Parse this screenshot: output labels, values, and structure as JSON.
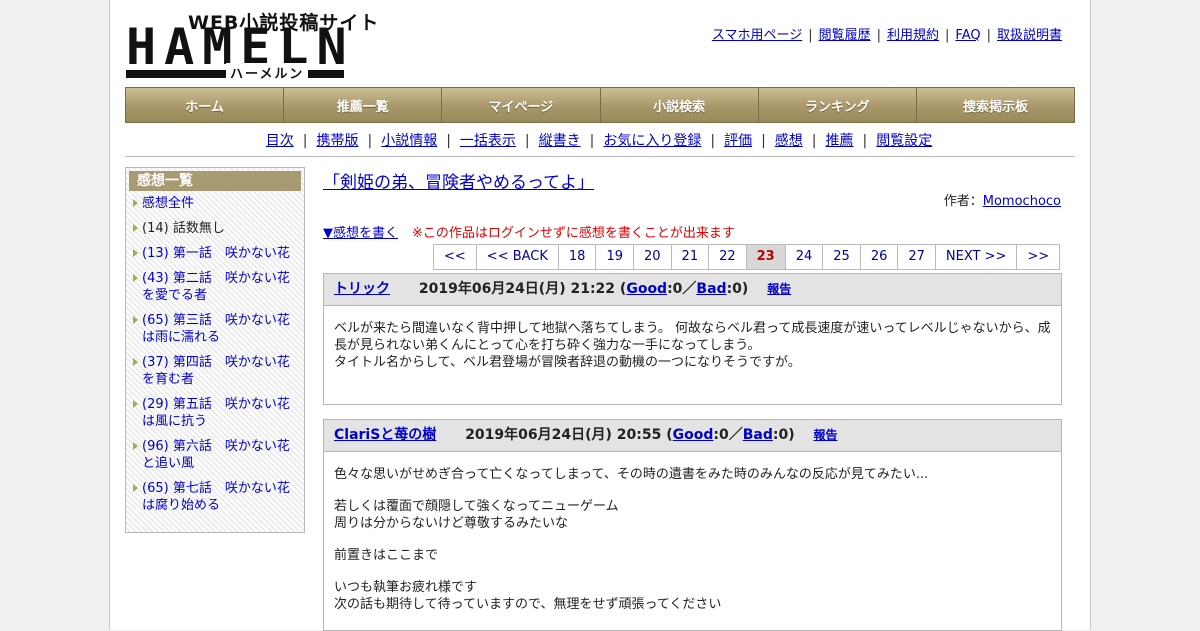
{
  "logo": {
    "tagline": "WEB小説投稿サイト",
    "wordmark": "HAMELN",
    "kana": "ハーメルン"
  },
  "header_links": [
    "スマホ用ページ",
    "閲覧履歴",
    "利用規約",
    "FAQ",
    "取扱説明書"
  ],
  "main_nav": [
    "ホーム",
    "推薦一覧",
    "マイページ",
    "小説検索",
    "ランキング",
    "捜索掲示板"
  ],
  "sub_nav": [
    "目次",
    "携帯版",
    "小説情報",
    "一括表示",
    "縦書き",
    "お気に入り登録",
    "評価",
    "感想",
    "推薦",
    "閲覧設定"
  ],
  "sidebar": {
    "title": "感想一覧",
    "items": [
      {
        "label": "感想全件",
        "link": true
      },
      {
        "label": "(14) 話数無し",
        "link": false
      },
      {
        "label": "(13) 第一話　咲かない花",
        "link": true
      },
      {
        "label": "(43) 第二話　咲かない花を愛でる者",
        "link": true
      },
      {
        "label": "(65) 第三話　咲かない花は雨に濡れる",
        "link": true
      },
      {
        "label": "(37) 第四話　咲かない花を育む者",
        "link": true
      },
      {
        "label": "(29) 第五話　咲かない花は風に抗う",
        "link": true
      },
      {
        "label": "(96) 第六話　咲かない花と追い風",
        "link": true
      },
      {
        "label": "(65) 第七話　咲かない花は腐り始める",
        "link": true
      }
    ]
  },
  "novel": {
    "title": "「剣姫の弟、冒険者やめるってよ」",
    "author_label": "作者：",
    "author_name": "Momochoco"
  },
  "write_review": {
    "link": "▼感想を書く",
    "note": "※この作品はログインせずに感想を書くことが出来ます"
  },
  "pager": {
    "items": [
      "<<",
      "<< BACK",
      "18",
      "19",
      "20",
      "21",
      "22",
      "23",
      "24",
      "25",
      "26",
      "27",
      "NEXT >>",
      ">>"
    ],
    "current": "23"
  },
  "reviews": [
    {
      "name": "トリック",
      "date": "2019年06月24日(月) 21:22",
      "good_label": "Good",
      "good_count": ":0",
      "bad_label": "Bad",
      "bad_count": ":0",
      "report": "報告",
      "paragraphs": [
        "ベルが来たら間違いなく背中押して地獄へ落ちてしまう。 何故ならベル君って成長速度が速いってレベルじゃないから、成長が見られない弟くんにとって心を打ち砕く強力な一手になってしまう。\nタイトル名からして、ベル君登場が冒険者辞退の動機の一つになりそうですが。"
      ]
    },
    {
      "name": "ClariSと苺の樹",
      "date": "2019年06月24日(月) 20:55",
      "good_label": "Good",
      "good_count": ":0",
      "bad_label": "Bad",
      "bad_count": ":0",
      "report": "報告",
      "paragraphs": [
        "色々な思いがせめぎ合って亡くなってしまって、その時の遺書をみた時のみんなの反応が見てみたい...",
        "若しくは覆面で顔隠して強くなってニューゲーム\n周りは分からないけど尊敬するみたいな",
        "前置きはここまで",
        "いつも執筆お疲れ様です\n次の話も期待して待っていますので、無理をせず頑張ってください"
      ]
    }
  ]
}
